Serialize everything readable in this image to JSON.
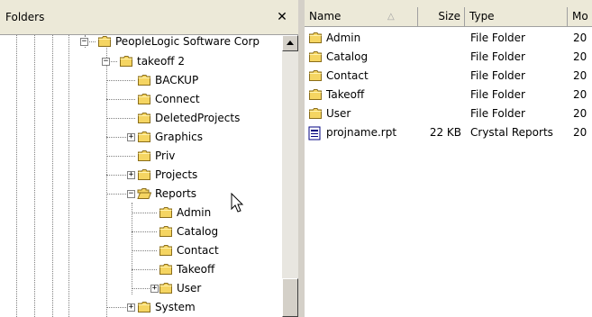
{
  "folders_pane": {
    "title": "Folders",
    "close_glyph": "✕",
    "tree": [
      {
        "label": "PeopleLogic Software Corp",
        "expander": "−"
      },
      {
        "label": "takeoff 2",
        "expander": "−"
      },
      {
        "label": "BACKUP",
        "expander": ""
      },
      {
        "label": "Connect",
        "expander": ""
      },
      {
        "label": "DeletedProjects",
        "expander": ""
      },
      {
        "label": "Graphics",
        "expander": "+"
      },
      {
        "label": "Priv",
        "expander": ""
      },
      {
        "label": "Projects",
        "expander": "+"
      },
      {
        "label": "Reports",
        "expander": "−"
      },
      {
        "label": "Admin",
        "expander": ""
      },
      {
        "label": "Catalog",
        "expander": ""
      },
      {
        "label": "Contact",
        "expander": ""
      },
      {
        "label": "Takeoff",
        "expander": ""
      },
      {
        "label": "User",
        "expander": "+"
      },
      {
        "label": "System",
        "expander": "+"
      }
    ]
  },
  "files_pane": {
    "columns": {
      "name": "Name",
      "sort_glyph": "△",
      "size": "Size",
      "type": "Type",
      "modified": "Mo"
    },
    "rows": [
      {
        "name": "Admin",
        "size": "",
        "type": "File Folder",
        "modified": "20",
        "icon": "folder-icon"
      },
      {
        "name": "Catalog",
        "size": "",
        "type": "File Folder",
        "modified": "20",
        "icon": "folder-icon"
      },
      {
        "name": "Contact",
        "size": "",
        "type": "File Folder",
        "modified": "20",
        "icon": "folder-icon"
      },
      {
        "name": "Takeoff",
        "size": "",
        "type": "File Folder",
        "modified": "20",
        "icon": "folder-icon"
      },
      {
        "name": "User",
        "size": "",
        "type": "File Folder",
        "modified": "20",
        "icon": "folder-icon"
      },
      {
        "name": "projname.rpt",
        "size": "22 KB",
        "type": "Crystal Reports",
        "modified": "20",
        "icon": "report-file-icon"
      }
    ]
  },
  "colors": {
    "folder_yellow": "#f5d562",
    "folder_outline": "#8a6d1a"
  }
}
